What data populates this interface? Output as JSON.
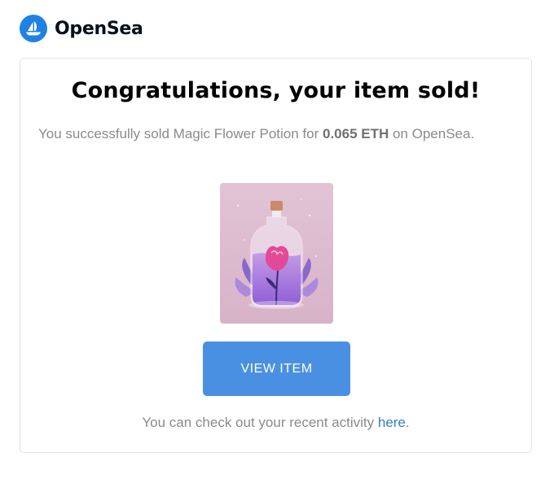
{
  "brand": {
    "name": "OpenSea",
    "logo_icon": "sailboat-icon",
    "color": "#2081E2"
  },
  "card": {
    "title": "Congratulations, your item sold!",
    "message_prefix": "You successfully sold Magic Flower Potion for ",
    "price": "0.065 ETH",
    "message_suffix": " on OpenSea.",
    "image": {
      "icon": "magic-flower-potion-bottle-image",
      "alt": "Magic Flower Potion",
      "background_color": "#d9b8c9",
      "potion_color": "#9b6fd8",
      "flower_color": "#e24a97"
    },
    "button": {
      "label": "VIEW ITEM",
      "color": "#4a90e2"
    },
    "footer_prefix": "You can check out your recent activity ",
    "footer_link": "here",
    "footer_suffix": ".",
    "link_color": "#2f7fc1"
  }
}
